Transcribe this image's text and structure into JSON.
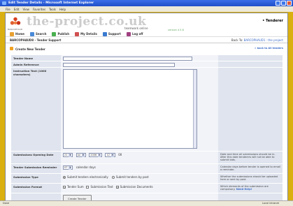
{
  "window": {
    "title": "Edit Tender Details - Microsoft Internet Explorer"
  },
  "menu": [
    "File",
    "Edit",
    "View",
    "Favorites",
    "Tools",
    "Help"
  ],
  "site": {
    "logo": "the-project.co.uk",
    "tagline": "teamwork online",
    "version": "version 4.5.6",
    "logo_caption": "BARCOPHAUD",
    "area": "• Tenderer"
  },
  "nav": [
    {
      "label": "Home",
      "icon": "home-icon",
      "color": "#e8a030"
    },
    {
      "label": "Search",
      "icon": "search-icon",
      "color": "#4a8ad8"
    },
    {
      "label": "Publish",
      "icon": "publish-icon",
      "color": "#4ab050"
    },
    {
      "label": "My Details",
      "icon": "user-icon",
      "color": "#d05050"
    },
    {
      "label": "Support",
      "icon": "help-icon",
      "color": "#3a7ad0"
    },
    {
      "label": "Log off",
      "icon": "logoff-icon",
      "color": "#a04080"
    }
  ],
  "breadcrumb": {
    "left": "BARCOPHAUD8 - Tender Support",
    "back_prefix": "Back To:",
    "back_link": "BARCOPHAUD1 : the project"
  },
  "section": {
    "title": "Create New Tender",
    "all_link": "» back to All tenders"
  },
  "form": {
    "tender_name": "Tender Name",
    "admin_ref": "Admin Reference",
    "instruction": "Instruction Text (1000 characters)",
    "opening_date": {
      "label": "Submissions Opening Date",
      "day": "21",
      "month": "Jul",
      "year": "2006",
      "hour": "12",
      "tz": "00",
      "help": "Date and time all submissions should be in. After this date tenderers will not be able to submit bids."
    },
    "reminder": {
      "label": "Tender Submission Reminder",
      "days": "07",
      "unit": "calendar days",
      "help": "Calendar days before tender is opened to email a reminder."
    },
    "sub_type": {
      "label": "Submission Type",
      "opt1": "Submit tenders electronically",
      "opt2": "Submit tenders by post",
      "help": "Whether the submissions should be uploaded here or sent by post."
    },
    "sub_format": {
      "label": "Submission Format",
      "opt1": "Tender Sum",
      "opt2": "Submission Text",
      "opt3": "Submission Documents",
      "help": "Which elements of the submission are compulsory.",
      "help_link": "Need Help!"
    },
    "submit": "Create Tender"
  },
  "status": {
    "left": "Done",
    "zone": "Local intranet"
  }
}
